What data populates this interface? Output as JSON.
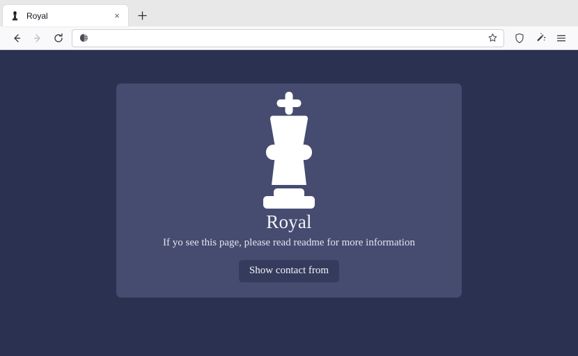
{
  "browser": {
    "tab": {
      "title": "Royal",
      "favicon_icon": "chess-pawn-icon",
      "close_icon": "close-icon",
      "close_label": "×"
    },
    "new_tab": {
      "icon": "plus-icon",
      "label": "+"
    },
    "toolbar": {
      "back_icon": "back-arrow-icon",
      "forward_icon": "forward-arrow-icon",
      "reload_icon": "reload-icon",
      "shield_icon": "shield-icon",
      "extension_icon": "magic-wand-icon",
      "menu_icon": "hamburger-menu-icon",
      "star_icon": "bookmark-star-icon"
    },
    "urlbar": {
      "value": "",
      "placeholder": "",
      "identity_icon": "permissions-circle-icon"
    }
  },
  "page": {
    "logo_icon": "chess-king-icon",
    "title": "Royal",
    "subtitle": "If yo see this page, please read readme for more information",
    "button_label": "Show contact from"
  },
  "colors": {
    "page_background": "#2b3151",
    "card_background": "#464c70",
    "button_background": "#353b5c",
    "text_light": "#f2f2f7",
    "logo_fill": "#ffffff"
  }
}
